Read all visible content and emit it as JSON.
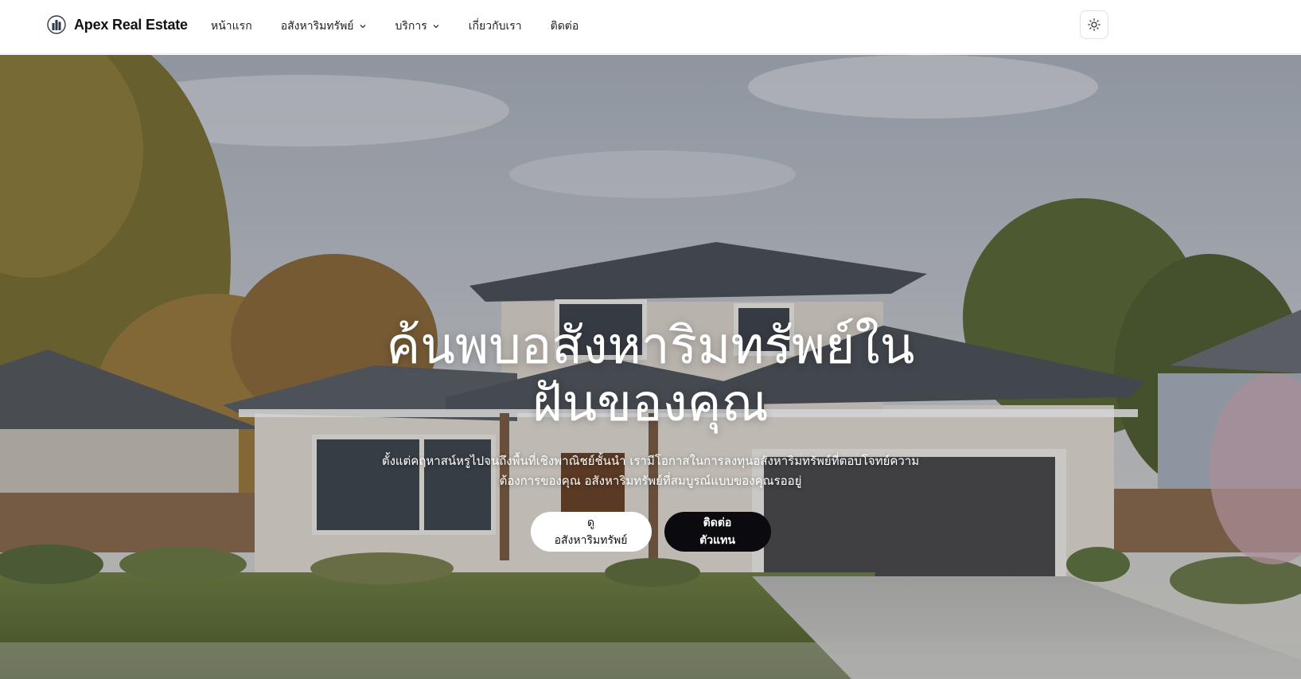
{
  "brand": {
    "name": "Apex Real Estate",
    "logo_icon": "building-logo-icon"
  },
  "nav": {
    "items": [
      {
        "label": "หน้าแรก",
        "has_dropdown": false
      },
      {
        "label": "อสังหาริมทรัพย์",
        "has_dropdown": true
      },
      {
        "label": "บริการ",
        "has_dropdown": true
      },
      {
        "label": "เกี่ยวกับเรา",
        "has_dropdown": false
      },
      {
        "label": "ติดต่อ",
        "has_dropdown": false
      }
    ],
    "theme_toggle_icon": "sun-icon"
  },
  "hero": {
    "title_line1": "ค้นพบอสังหาริมทรัพย์ใน",
    "title_line2": "ฝันของคุณ",
    "subtitle_line1": "ตั้งแต่คฤหาสน์หรูไปจนถึงพื้นที่เชิงพาณิชย์ชั้นนำ เรามีโอกาสในการลงทุนอสังหาริมทรัพย์ที่ตอบโจทย์ความ",
    "subtitle_line2": "ต้องการของคุณ อสังหาริมทรัพย์ที่สมบูรณ์แบบของคุณรออยู่",
    "primary_button": "ดูอสังหาริมทรัพย์",
    "secondary_button": "ติดต่อตัวแทน",
    "background_image": "suburban-house-photo"
  },
  "colors": {
    "nav_bg": "#ffffff",
    "dark_button": "#0b0b0f",
    "light_button": "#ffffff",
    "hero_text": "#ffffff"
  }
}
